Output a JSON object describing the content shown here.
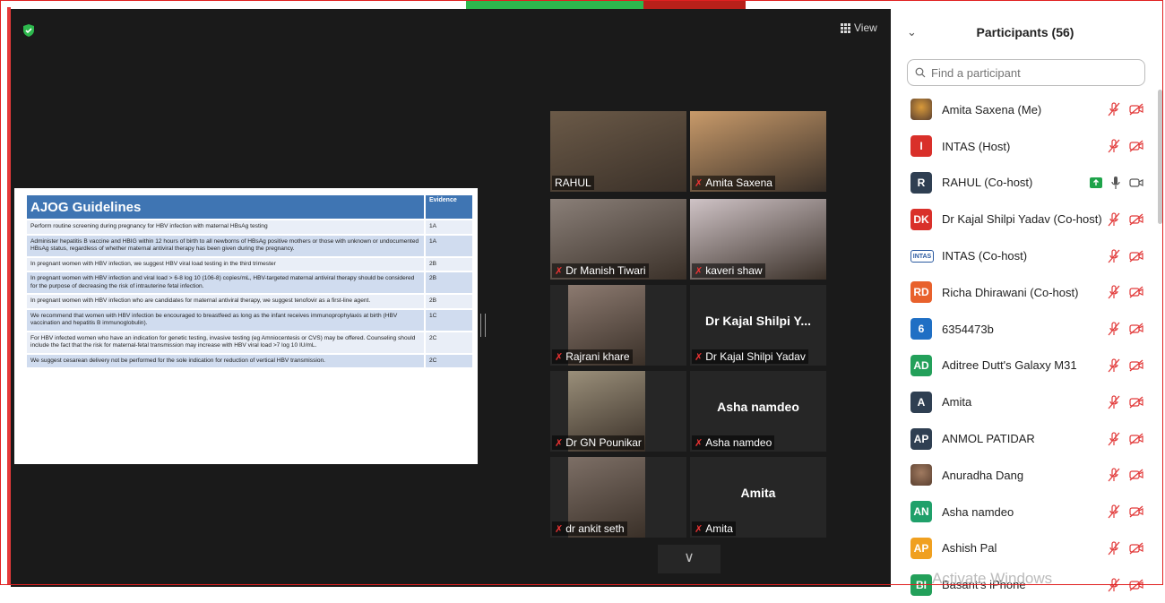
{
  "topbar": {
    "colors": [
      "#2db84d",
      "#b8201a"
    ]
  },
  "meeting": {
    "view_label": "View",
    "slide": {
      "title": "AJOG Guidelines",
      "evidence_header": "Evidence",
      "rows": [
        {
          "text": "Perform routine screening during pregnancy for HBV infection with maternal HBsAg testing",
          "evidence": "1A"
        },
        {
          "text": "Administer hepatitis B vaccine and HBIG within 12 hours of birth to all newborns of HBsAg positive mothers or those with unknown or undocumented HBsAg status, regardless of whether maternal antiviral therapy has been given during the pregnancy.",
          "evidence": "1A"
        },
        {
          "text": "In pregnant women with HBV infection, we suggest HBV viral load testing in the third trimester",
          "evidence": "2B"
        },
        {
          "text": "In pregnant women with HBV infection and viral load > 6-8 log 10 (106-8) copies/mL, HBV-targeted maternal antiviral therapy should be considered for the purpose of decreasing the risk of intrauterine fetal infection.",
          "evidence": "2B"
        },
        {
          "text": "In pregnant women with HBV infection who are candidates for maternal antiviral therapy, we suggest tenofovir as a first-line agent.",
          "evidence": "2B"
        },
        {
          "text": "We recommend that women with HBV infection be encouraged to breastfeed as long as the infant receives immunoprophylaxis at birth (HBV vaccination and hepatitis B immunoglobulin).",
          "evidence": "1C"
        },
        {
          "text": "For HBV infected women who have an indication for genetic testing, invasive testing (eg Amniocentesis or CVS) may be offered. Counseling should include the fact that the risk for maternal-fetal transmission may increase with HBV viral load >7 log 10 IU/mL.",
          "evidence": "2C"
        },
        {
          "text": "We suggest cesarean delivery not be performed for the sole indication for reduction of vertical HBV transmission.",
          "evidence": "2C"
        }
      ]
    },
    "tiles": [
      {
        "name": "RAHUL",
        "muted": false,
        "active": true,
        "photo_color": "#6b5a48"
      },
      {
        "name": "Amita Saxena",
        "muted": true,
        "active": false,
        "photo_color": "#c89a6a"
      },
      {
        "name": "Dr Manish Tiwari",
        "muted": true,
        "active": false,
        "photo_color": "#8a7f78"
      },
      {
        "name": "kaveri shaw",
        "muted": true,
        "active": false,
        "photo_color": "#cfc3c6"
      },
      {
        "name": "Rajrani  khare",
        "muted": true,
        "active": false,
        "photo_color": "#8c7a70"
      },
      {
        "name": "Dr Kajal Shilpi Yadav",
        "muted": true,
        "active": false,
        "big_name": "Dr Kajal Shilpi Y..."
      },
      {
        "name": "Dr GN Pounikar",
        "muted": true,
        "active": false,
        "photo_color": "#9a8f7a"
      },
      {
        "name": "Asha namdeo",
        "muted": true,
        "active": false,
        "big_name": "Asha namdeo"
      },
      {
        "name": "dr ankit seth",
        "muted": true,
        "active": false,
        "photo_color": "#7d6f66"
      },
      {
        "name": "Amita",
        "muted": true,
        "active": false,
        "big_name": "Amita"
      }
    ],
    "more_label": "∨"
  },
  "participants": {
    "title": "Participants (56)",
    "search_placeholder": "Find a participant",
    "list": [
      {
        "initials": "",
        "name": "Amita Saxena (Me)",
        "color": "#d99a3a",
        "photo": true
      },
      {
        "initials": "I",
        "name": "INTAS (Host)",
        "color": "#d9302a"
      },
      {
        "initials": "R",
        "name": "RAHUL (Co-host)",
        "color": "#2f3f52",
        "unmuted": true
      },
      {
        "initials": "DK",
        "name": "Dr Kajal Shilpi Yadav (Co-host)",
        "color": "#d9302a"
      },
      {
        "initials": "INTAS",
        "name": "INTAS (Co-host)",
        "color": "#ffffff",
        "logo": true
      },
      {
        "initials": "RD",
        "name": "Richa Dhirawani (Co-host)",
        "color": "#e8612c"
      },
      {
        "initials": "6",
        "name": "6354473b",
        "color": "#1f6fc4"
      },
      {
        "initials": "AD",
        "name": "Aditree Dutt's Galaxy M31",
        "color": "#23a05a"
      },
      {
        "initials": "A",
        "name": "Amita",
        "color": "#2f3f52"
      },
      {
        "initials": "AP",
        "name": "ANMOL PATIDAR",
        "color": "#2f3f52"
      },
      {
        "initials": "",
        "name": "Anuradha Dang",
        "color": "#a07a60",
        "photo": true
      },
      {
        "initials": "AN",
        "name": "Asha namdeo",
        "color": "#1fa06a"
      },
      {
        "initials": "AP",
        "name": "Ashish Pal",
        "color": "#f0a020"
      },
      {
        "initials": "BI",
        "name": "Basant's iPhone",
        "color": "#23a05a"
      }
    ]
  },
  "watermark": "Activate Windows"
}
